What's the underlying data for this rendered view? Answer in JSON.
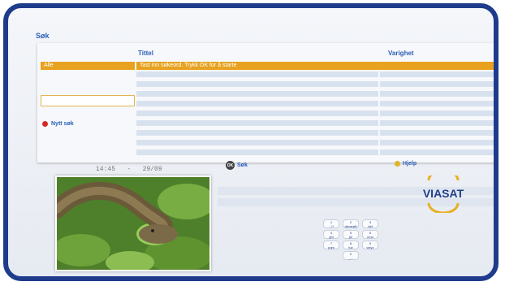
{
  "screen": {
    "title": "Søk"
  },
  "table": {
    "col_title": "Tittel",
    "col_duration": "Varighet",
    "category_selected": "Alle",
    "prompt_row": "Tast inn søkeord. Trykk OK for å starte"
  },
  "side": {
    "new_search": "Nytt søk",
    "search_input_value": ""
  },
  "status": {
    "time": "14:45",
    "sep": "-",
    "date": "29/09"
  },
  "buttons": {
    "ok_label": "OK",
    "search_label": "Søk",
    "help_label": "Hjelp"
  },
  "brand": {
    "logo_text": "VIASAT"
  },
  "keypad": {
    "keys": [
      {
        "digit": "1",
        "letters": ".,?!"
      },
      {
        "digit": "2",
        "letters": "abcæøå"
      },
      {
        "digit": "3",
        "letters": "def"
      },
      {
        "digit": "4",
        "letters": "ghi"
      },
      {
        "digit": "5",
        "letters": "jkl"
      },
      {
        "digit": "6",
        "letters": "mno"
      },
      {
        "digit": "7",
        "letters": "pqrs"
      },
      {
        "digit": "8",
        "letters": "tuv"
      },
      {
        "digit": "9",
        "letters": "wxyz"
      },
      {
        "digit": "0",
        "letters": "_ -"
      }
    ]
  },
  "colors": {
    "frame": "#1f3b8c",
    "accent": "#e8a21f",
    "red": "#d12a2a",
    "yellow": "#e0b12a",
    "text": "#2a5fb8"
  }
}
